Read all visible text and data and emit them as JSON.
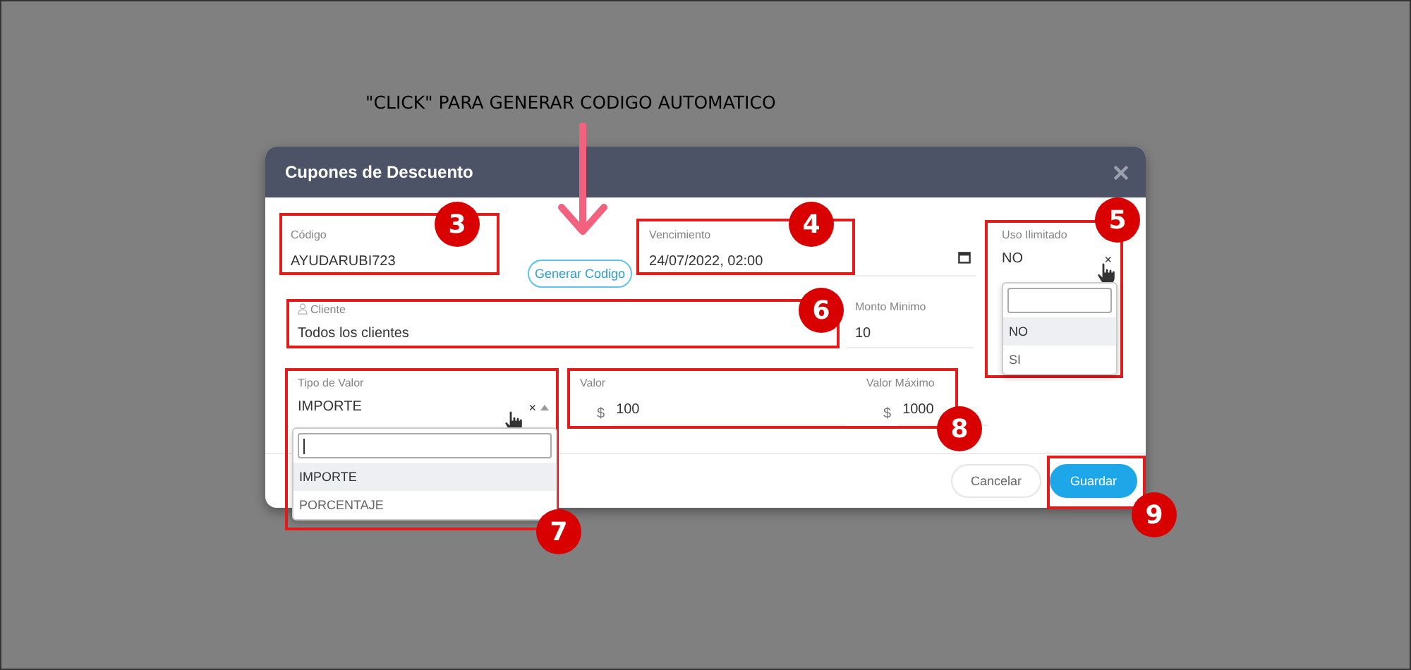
{
  "caption": "\"CLICK\" PARA GENERAR CODIGO AUTOMATICO",
  "dialog": {
    "title": "Cupones de Descuento",
    "codigo": {
      "label": "Código",
      "value": "AYUDARUBI723"
    },
    "generate_button": "Generar Codigo",
    "vencimiento": {
      "label": "Vencimiento",
      "value": "24/07/2022, 02:00"
    },
    "uso_ilimitado": {
      "label": "Uso Ilimitado",
      "value": "NO",
      "clear": "×",
      "expanded": true,
      "options": [
        {
          "label": "NO",
          "selected": true
        },
        {
          "label": "SI",
          "selected": false
        }
      ]
    },
    "cliente": {
      "label": "Cliente",
      "value": "Todos los clientes"
    },
    "monto_minimo": {
      "label": "Monto Minimo",
      "value": "10"
    },
    "tipo_de_valor": {
      "label": "Tipo de Valor",
      "value": "IMPORTE",
      "clear": "×",
      "expanded": true,
      "options": [
        {
          "label": "IMPORTE",
          "selected": true
        },
        {
          "label": "PORCENTAJE",
          "selected": false
        }
      ]
    },
    "valor": {
      "label": "Valor",
      "prefix": "$",
      "value": "100"
    },
    "valor_maximo": {
      "label": "Valor Máximo",
      "prefix": "$",
      "value": "1000"
    },
    "buttons": {
      "cancel": "Cancelar",
      "save": "Guardar"
    }
  },
  "annotations": [
    {
      "number": "3"
    },
    {
      "number": "4"
    },
    {
      "number": "5"
    },
    {
      "number": "6"
    },
    {
      "number": "7"
    },
    {
      "number": "8"
    },
    {
      "number": "9"
    }
  ]
}
